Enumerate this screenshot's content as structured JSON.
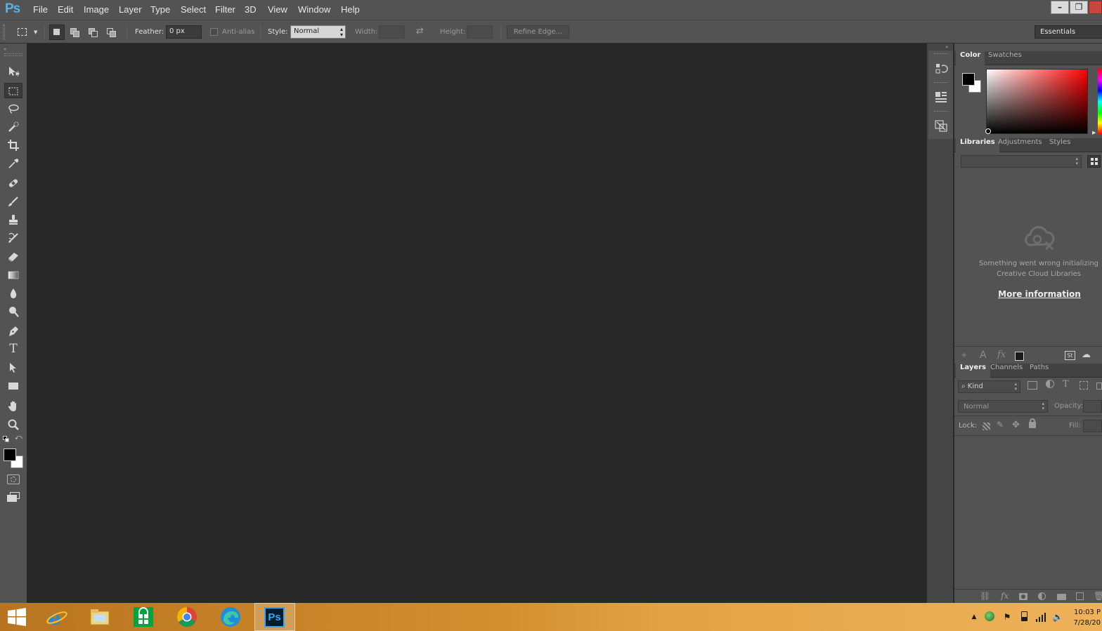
{
  "app": {
    "logo": "Ps",
    "menu": [
      "File",
      "Edit",
      "Image",
      "Layer",
      "Type",
      "Select",
      "Filter",
      "3D",
      "View",
      "Window",
      "Help"
    ]
  },
  "options": {
    "feather_label": "Feather:",
    "feather_value": "0 px",
    "antialias_label": "Anti-alias",
    "style_label": "Style:",
    "style_value": "Normal",
    "width_label": "Width:",
    "height_label": "Height:",
    "refine_edge": "Refine Edge...",
    "workspace": "Essentials"
  },
  "tools": [
    {
      "name": "move-tool",
      "icon": "move-icon"
    },
    {
      "name": "marquee-tool",
      "icon": "marquee-icon",
      "active": true
    },
    {
      "name": "lasso-tool",
      "icon": "lasso-icon"
    },
    {
      "name": "quick-selection-tool",
      "icon": "quick-select-icon"
    },
    {
      "name": "crop-tool",
      "icon": "crop-icon"
    },
    {
      "name": "eyedropper-tool",
      "icon": "eyedropper-icon"
    },
    {
      "name": "healing-brush-tool",
      "icon": "bandage-icon"
    },
    {
      "name": "brush-tool",
      "icon": "brush-icon"
    },
    {
      "name": "clone-stamp-tool",
      "icon": "stamp-icon"
    },
    {
      "name": "history-brush-tool",
      "icon": "history-brush-icon"
    },
    {
      "name": "eraser-tool",
      "icon": "eraser-icon"
    },
    {
      "name": "gradient-tool",
      "icon": "gradient-icon"
    },
    {
      "name": "blur-tool",
      "icon": "drop-icon"
    },
    {
      "name": "dodge-tool",
      "icon": "dodge-icon"
    },
    {
      "name": "pen-tool",
      "icon": "pen-icon"
    },
    {
      "name": "type-tool",
      "icon": "type-icon"
    },
    {
      "name": "path-selection-tool",
      "icon": "arrow-icon"
    },
    {
      "name": "rectangle-tool",
      "icon": "rectangle-icon"
    },
    {
      "name": "hand-tool",
      "icon": "hand-icon"
    },
    {
      "name": "zoom-tool",
      "icon": "zoom-icon"
    }
  ],
  "panels": {
    "color_tabs": [
      "Color",
      "Swatches"
    ],
    "colors": {
      "foreground": "#000000",
      "background": "#ffffff",
      "hue": "#ff0000"
    },
    "library_tabs": [
      "Libraries",
      "Adjustments",
      "Styles"
    ],
    "library_error_line1": "Something went wrong initializing",
    "library_error_line2": "Creative Cloud Libraries",
    "library_more_info": "More information",
    "layer_tabs": [
      "Layers",
      "Channels",
      "Paths"
    ],
    "kind_label": "Kind",
    "blend_mode": "Normal",
    "opacity_label": "Opacity:",
    "lock_label": "Lock:",
    "fill_label": "Fill:"
  },
  "taskbar": {
    "apps": [
      "internet-explorer",
      "file-explorer",
      "store",
      "chrome",
      "edge",
      "photoshop"
    ],
    "ps_label": "Ps",
    "time": "10:03 P",
    "date": "7/28/20"
  }
}
